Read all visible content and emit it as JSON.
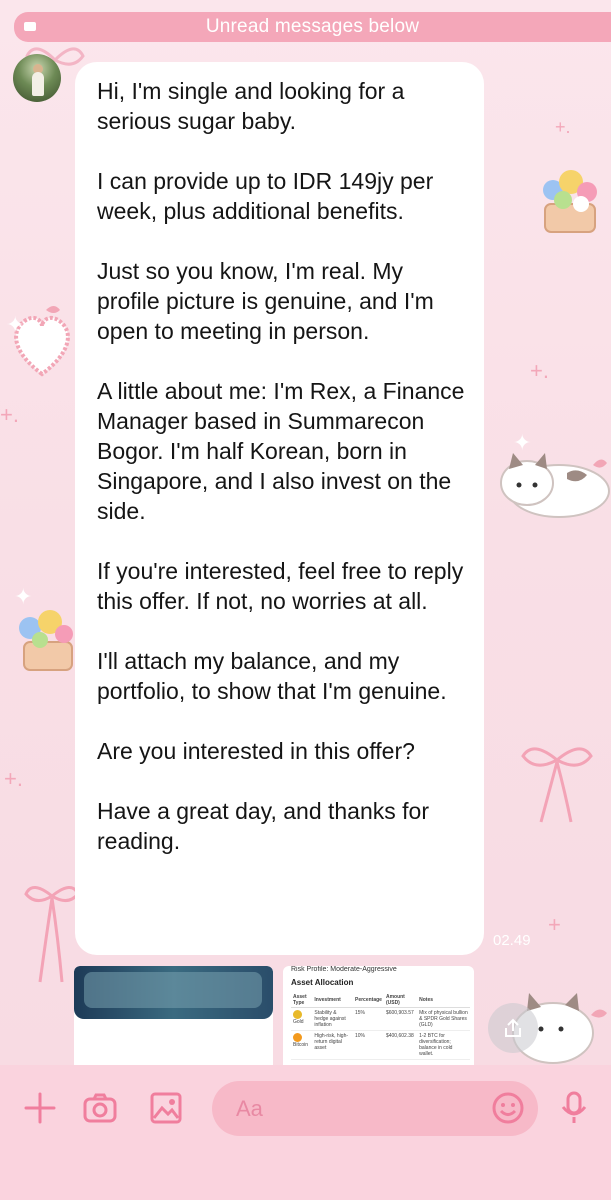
{
  "banner": {
    "unread_text": "Unread messages below"
  },
  "message": {
    "paragraphs": [
      "Hi, I'm single and looking for a serious sugar baby.",
      "I can provide up to IDR 149jy per week, plus additional benefits.",
      "Just so you know, I'm real. My profile picture is genuine, and I'm open to meeting in person.",
      "A little about me: I'm Rex, a Finance Manager based in Summarecon Bogor. I'm half Korean, born in Singapore, and I also invest on the side.",
      "If you're interested, feel free to reply this offer. If not, no worries at all.",
      "I'll attach my balance, and my portfolio, to show that I'm genuine.",
      "Are you interested in this offer?",
      "Have a great day, and thanks for reading."
    ],
    "time": "02.49"
  },
  "attachment": {
    "risk_profile": "Risk Profile: Moderate-Aggressive",
    "heading": "Asset Allocation",
    "columns": [
      "Asset Type",
      "Investment",
      "Percentage",
      "Amount (USD)",
      "Notes"
    ],
    "rows": [
      {
        "asset": "Gold",
        "investment": "Stability & hedge against inflation",
        "percentage": "15%",
        "amount": "$600,903.57",
        "notes": "Mix of physical bullion & SPDR Gold Shares (GLD)",
        "color": "#e8b92a"
      },
      {
        "asset": "Bitcoin",
        "investment": "High-risk, high-return digital asset",
        "percentage": "10%",
        "amount": "$400,602.38",
        "notes": "1-2 BTC for diversification; balance in cold wallet.",
        "color": "#f39a1e"
      }
    ]
  },
  "composer": {
    "placeholder": "Aa",
    "icons": [
      "plus-icon",
      "camera-icon",
      "image-icon",
      "emoji-icon",
      "microphone-icon",
      "share-icon"
    ]
  },
  "colors": {
    "accent": "#f4a7b9",
    "bubble": "#ffffff",
    "input_bar": "#fad3de",
    "input_field": "#f7b9c8"
  }
}
